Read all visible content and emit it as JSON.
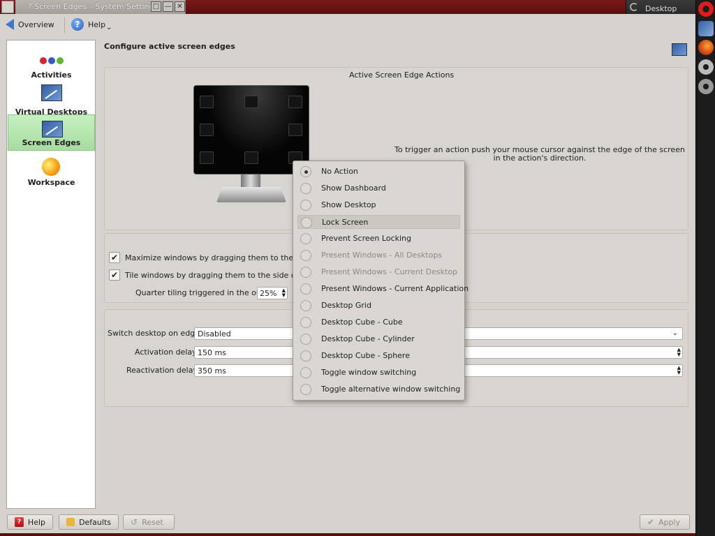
{
  "window": {
    "title": "? Screen Edges – System Settings",
    "right_task": "Desktop",
    "btn_keep": "□",
    "btn_min": "—",
    "btn_close": "✕"
  },
  "toolbar": {
    "overview_label": "Overview",
    "help_label": "Help",
    "more": "⌄"
  },
  "sidebar": {
    "items": [
      {
        "label": "Activities"
      },
      {
        "label": "Virtual Desktops"
      },
      {
        "label": "Screen Edges"
      },
      {
        "label": "Workspace"
      }
    ],
    "selected": "Screen Edges"
  },
  "main": {
    "title": "Configure active screen edges",
    "edge_panel_title": "Active Screen Edge Actions",
    "trigger_text": "To trigger an action push your mouse cursor against the edge of the screen in the action's direction.",
    "maximize_label": "Maximize windows by dragging them to the top of",
    "maximize_checked": "✔",
    "tile_label": "Tile windows by dragging them to the side of the s",
    "tile_checked": "✔",
    "quarter_label": "Quarter tiling triggered in the outer",
    "quarter_value": "25%",
    "switch_label": "Switch desktop on edge:",
    "switch_value": "Disabled",
    "activation_label": "Activation delay:",
    "activation_value": "150 ms",
    "reactivation_label": "Reactivation delay:",
    "reactivation_value": "350 ms"
  },
  "popup": {
    "options": [
      {
        "label": "No Action",
        "selected": true,
        "enabled": true
      },
      {
        "label": "Show Dashboard",
        "enabled": true
      },
      {
        "label": "Show Desktop",
        "enabled": true
      },
      {
        "label": "Lock Screen",
        "enabled": true,
        "highlighted": true
      },
      {
        "label": "Prevent Screen Locking",
        "enabled": true
      },
      {
        "label": "Present Windows - All Desktops",
        "enabled": false
      },
      {
        "label": "Present Windows - Current Desktop",
        "enabled": false
      },
      {
        "label": "Present Windows - Current Application",
        "enabled": true
      },
      {
        "label": "Desktop Grid",
        "enabled": true
      },
      {
        "label": "Desktop Cube - Cube",
        "enabled": true
      },
      {
        "label": "Desktop Cube - Cylinder",
        "enabled": true
      },
      {
        "label": "Desktop Cube - Sphere",
        "enabled": true
      },
      {
        "label": "Toggle window switching",
        "enabled": true
      },
      {
        "label": "Toggle alternative window switching",
        "enabled": true
      }
    ]
  },
  "bottom": {
    "help_label": "Help",
    "defaults_label": "Defaults",
    "reset_label": "Reset",
    "apply_label": "Apply"
  },
  "colors": {
    "titlebar": "#5a0f0f",
    "selected_item": "#b8e6b0",
    "accent": "#3f78c8"
  }
}
